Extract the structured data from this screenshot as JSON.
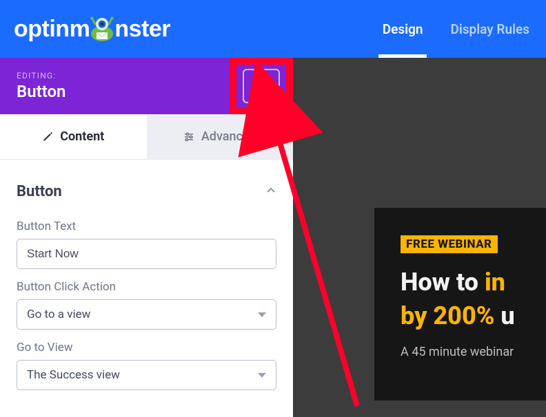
{
  "brand": {
    "name_left": "optinm",
    "name_right": "nster"
  },
  "topnav": {
    "design": "Design",
    "display_rules": "Display Rules"
  },
  "editbar": {
    "label": "EDITING:",
    "title": "Button"
  },
  "subtabs": {
    "content": "Content",
    "advanced": "Advanced"
  },
  "section": {
    "heading": "Button"
  },
  "fields": {
    "button_text": {
      "label": "Button Text",
      "value": "Start Now"
    },
    "click_action": {
      "label": "Button Click Action",
      "value": "Go to a view"
    },
    "go_to_view": {
      "label": "Go to View",
      "value": "The Success view"
    }
  },
  "promo": {
    "badge": "FREE WEBINAR",
    "line1_a": "How to ",
    "line1_b": "in",
    "line2_a": "by 200% ",
    "line2_b": "u",
    "sub": "A 45 minute webinar "
  }
}
